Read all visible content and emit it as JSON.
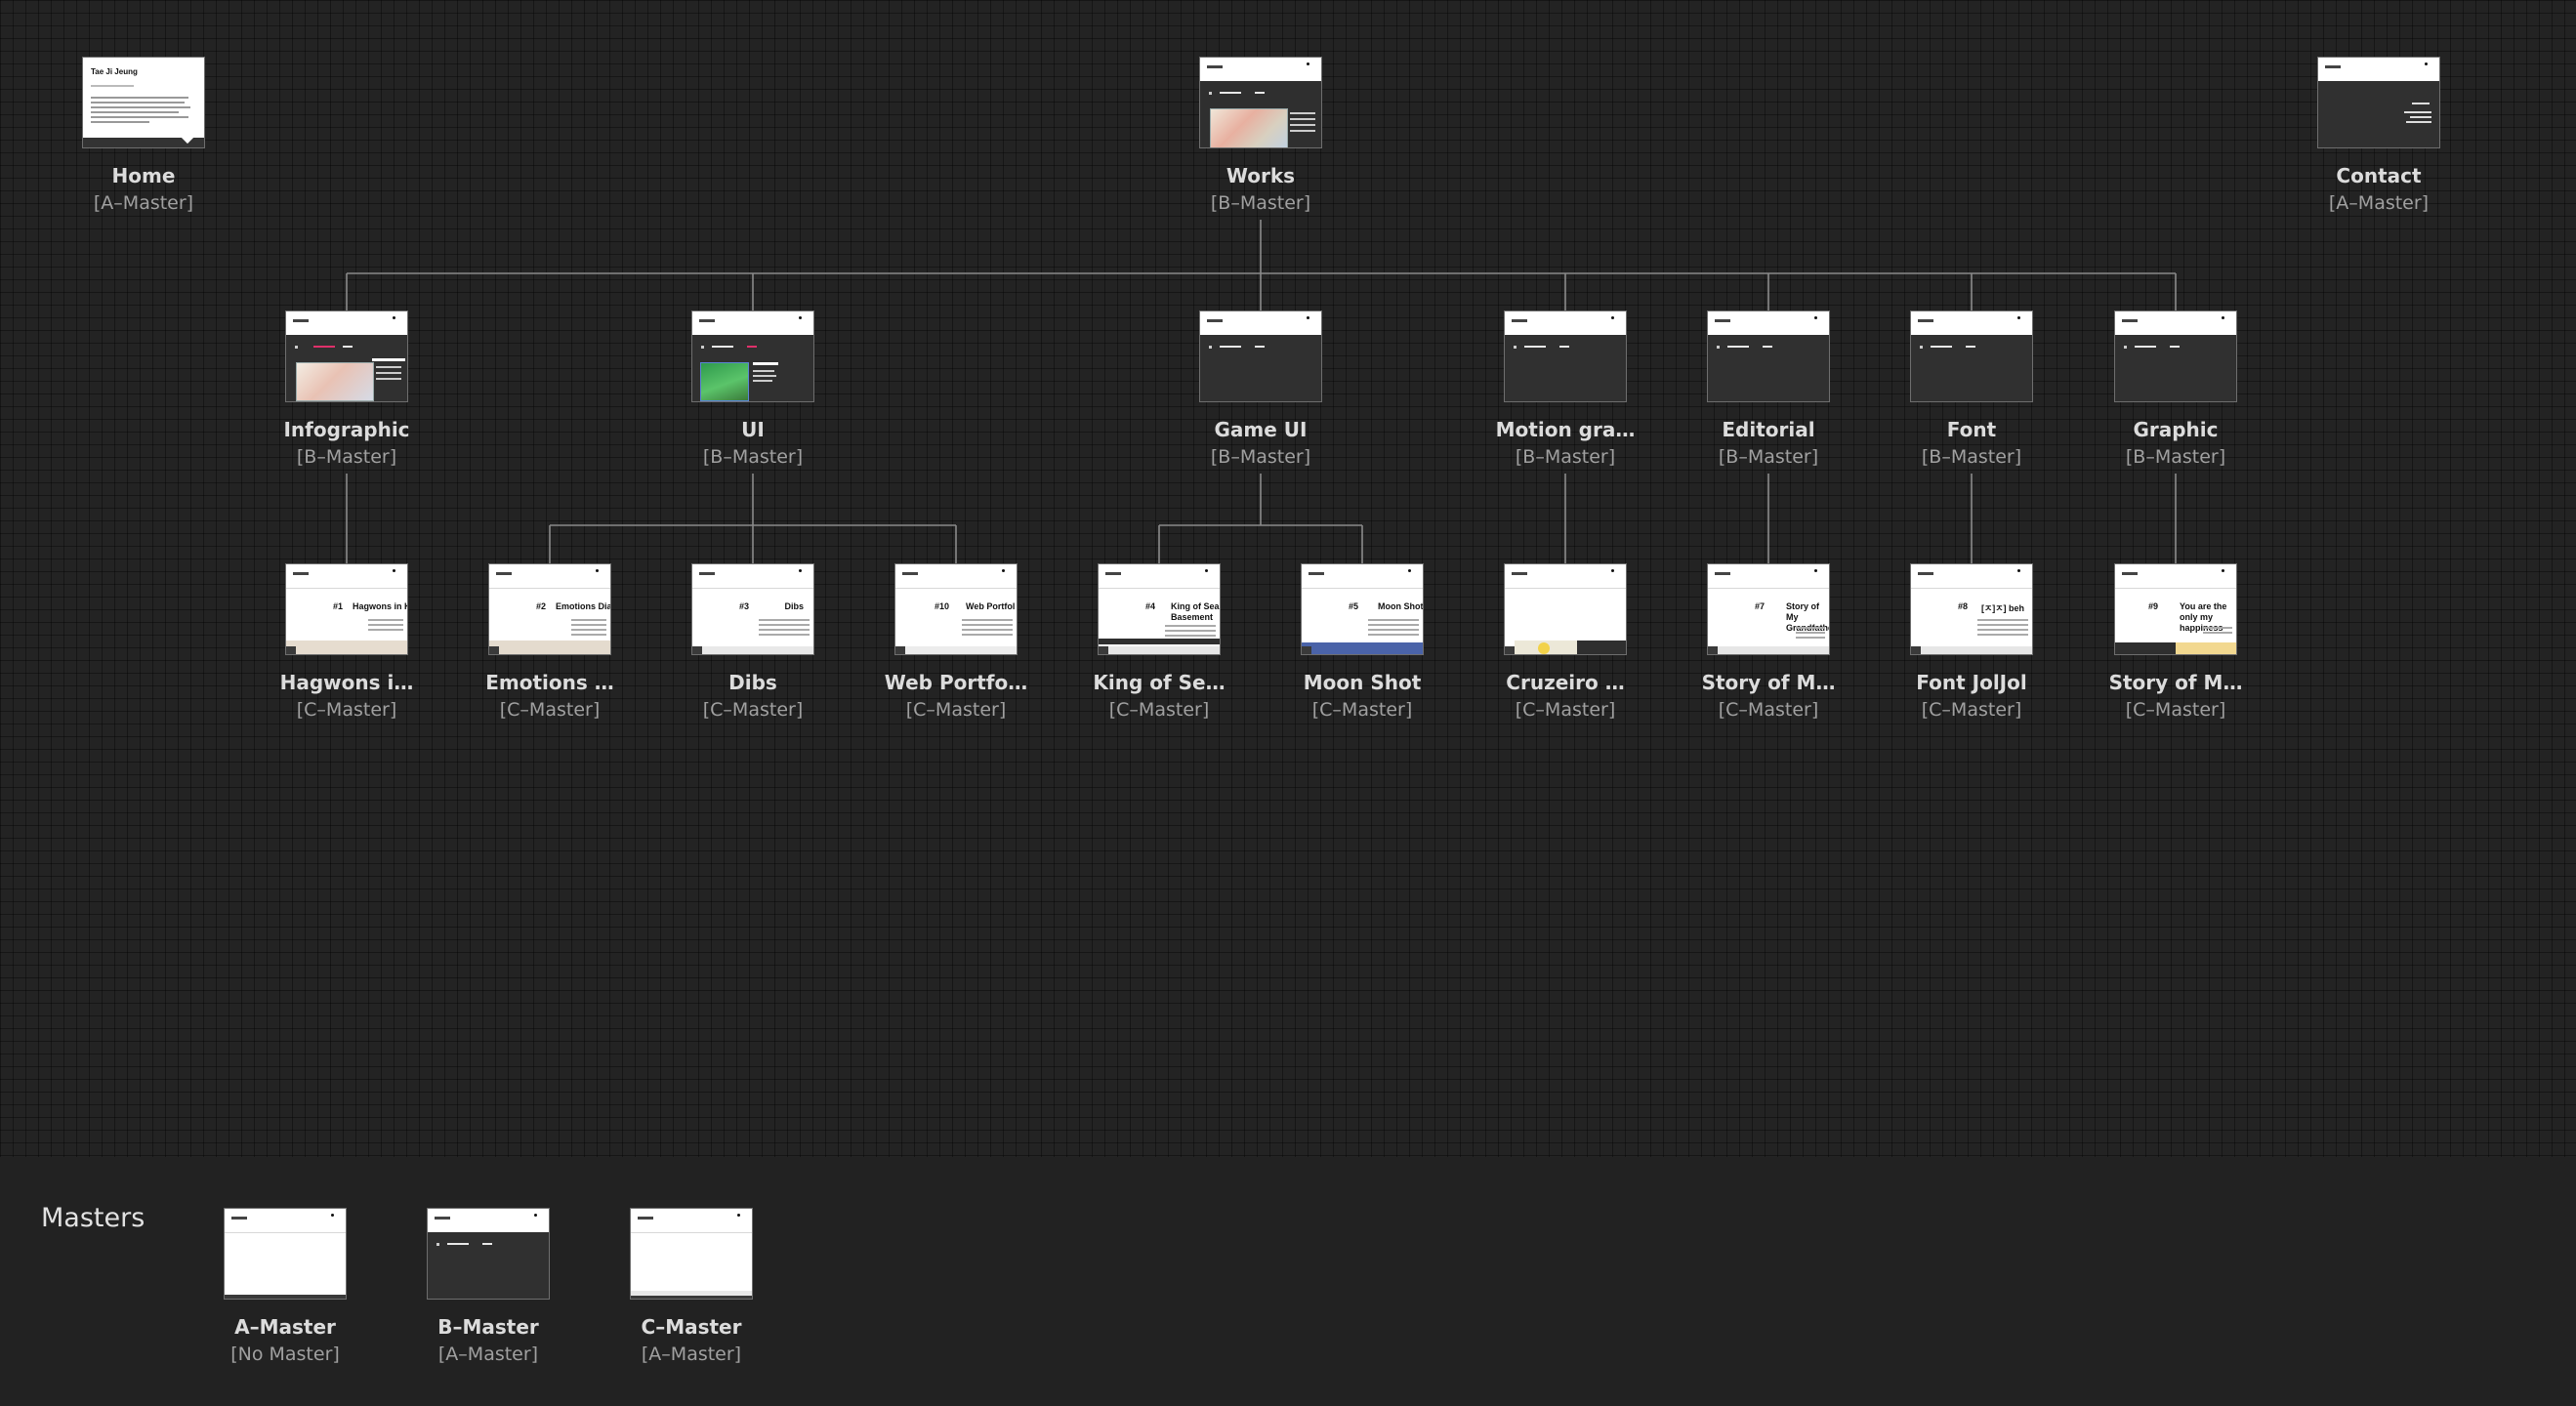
{
  "nodes": {
    "home": {
      "title": "Home",
      "master": "[A–Master]",
      "thumb_heading": "Tae Ji Jeung"
    },
    "works": {
      "title": "Works",
      "master": "[B–Master]"
    },
    "contact": {
      "title": "Contact",
      "master": "[A–Master]"
    },
    "infographic": {
      "title": "Infographic",
      "master": "[B–Master]"
    },
    "ui": {
      "title": "UI",
      "master": "[B–Master]"
    },
    "game_ui": {
      "title": "Game UI",
      "master": "[B–Master]"
    },
    "motion": {
      "title": "Motion gra…",
      "master": "[B–Master]"
    },
    "editorial": {
      "title": "Editorial",
      "master": "[B–Master]"
    },
    "font": {
      "title": "Font",
      "master": "[B–Master]"
    },
    "graphic": {
      "title": "Graphic",
      "master": "[B–Master]"
    },
    "hagwons": {
      "title": "Hagwons i…",
      "master": "[C–Master]",
      "num": "#1",
      "heading": "Hagwons in Ko"
    },
    "emotions": {
      "title": "Emotions …",
      "master": "[C–Master]",
      "num": "#2",
      "heading": "Emotions Dia"
    },
    "dibs": {
      "title": "Dibs",
      "master": "[C–Master]",
      "num": "#3",
      "heading": "Dibs"
    },
    "web_portfolio": {
      "title": "Web Portfo…",
      "master": "[C–Master]",
      "num": "#10",
      "heading": "Web Portfol"
    },
    "king": {
      "title": "King of Se…",
      "master": "[C–Master]",
      "num": "#4",
      "heading": "King of Sea Basement"
    },
    "moon_shot": {
      "title": "Moon Shot",
      "master": "[C–Master]",
      "num": "#5",
      "heading": "Moon Shot"
    },
    "cruzeiro": {
      "title": "Cruzeiro …",
      "master": "[C–Master]"
    },
    "story1": {
      "title": "Story of M…",
      "master": "[C–Master]",
      "num": "#7",
      "heading": "Story of My Grandfather"
    },
    "font_joljol": {
      "title": "Font JolJol",
      "master": "[C–Master]",
      "num": "#8",
      "heading": "[ㅈ]ㅈ] beh"
    },
    "story2": {
      "title": "Story of M…",
      "master": "[C–Master]",
      "num": "#9",
      "heading": "You are the only my happiness"
    }
  },
  "masters_section": {
    "label": "Masters",
    "a": {
      "title": "A–Master",
      "master": "[No Master]"
    },
    "b": {
      "title": "B–Master",
      "master": "[A–Master]"
    },
    "c": {
      "title": "C–Master",
      "master": "[A–Master]"
    }
  }
}
